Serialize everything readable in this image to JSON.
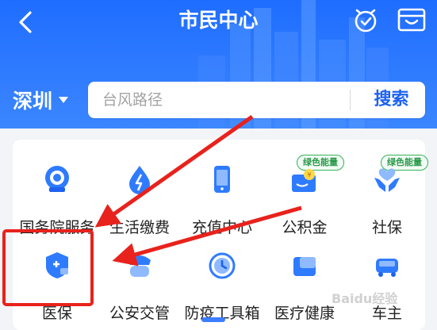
{
  "header": {
    "title": "市民中心",
    "back_icon": "back-arrow-icon",
    "alarm_icon": "alarm-clock-icon",
    "wallet_icon": "wallet-icon"
  },
  "city_selector": {
    "city": "深圳"
  },
  "search": {
    "placeholder": "台风路径",
    "button_label": "搜索"
  },
  "services_row1": [
    {
      "label": "国务院服务",
      "icon": "state-council-icon",
      "badge": ""
    },
    {
      "label": "生活缴费",
      "icon": "utility-payment-icon",
      "badge": ""
    },
    {
      "label": "充值中心",
      "icon": "phone-recharge-icon",
      "badge": ""
    },
    {
      "label": "公积金",
      "icon": "housing-fund-icon",
      "badge": "绿色能量"
    },
    {
      "label": "社保",
      "icon": "social-security-icon",
      "badge": "绿色能量"
    }
  ],
  "services_row2": [
    {
      "label": "医保",
      "icon": "medical-insurance-icon"
    },
    {
      "label": "公安交管",
      "icon": "traffic-police-icon"
    },
    {
      "label": "防疫工具箱",
      "icon": "epidemic-toolbox-icon"
    },
    {
      "label": "医疗健康",
      "icon": "medical-health-icon"
    },
    {
      "label": "车主",
      "icon": "car-owner-icon"
    }
  ],
  "watermark": "Baidu经验",
  "colors": {
    "header_blue": "#2f7bff",
    "annotation_red": "#e8221c",
    "badge_green": "#34b35a",
    "search_blue": "#1d62f0"
  }
}
